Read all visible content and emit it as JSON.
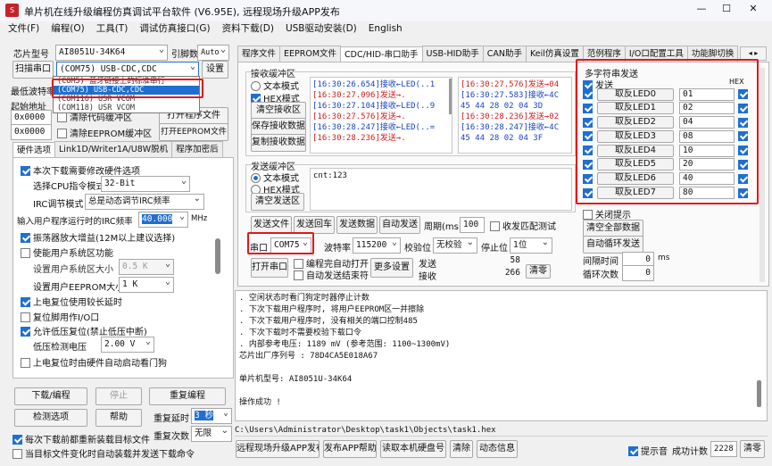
{
  "window": {
    "title": "单片机在线升级编程仿真调试平台软件 (V6.95E), 远程现场升级APP发布",
    "minimize": "—",
    "maximize": "☐",
    "close": "✕"
  },
  "menu": [
    "文件(F)",
    "编程(O)",
    "工具(T)",
    "调试仿真接口(G)",
    "资料下载(D)",
    "USB驱动安装(D)",
    "English"
  ],
  "left": {
    "chip_label": "芯片型号",
    "chip_value": "AI8051U-34K64",
    "pin_label": "引脚数",
    "pin_value": "Auto",
    "scan_button": "扫描串口",
    "port_value": "(COM75) USB-CDC,CDC",
    "settings_button": "设置",
    "dropdown_items": [
      "(COM5) 蓝牙链接上的标准串行",
      "(COM75) USB-CDC,CDC",
      "(COM116) USR VCOM",
      "(COM118) USR VCOM"
    ],
    "baud_label": "最低波特率",
    "start_label": "起始地址",
    "addr1": "0x0000",
    "clear_code": "清除代码缓冲区",
    "open_prog": "打开程序文件",
    "addr2": "0x0000",
    "clear_eeprom": "清除EEPROM缓冲区",
    "open_eeprom": "打开EEPROM文件",
    "tabs": [
      "硬件选项",
      "Link1D/Writer1A/U8W脱机",
      "程序加密后"
    ],
    "hw": {
      "need_modify": "本次下载需要修改硬件选项",
      "cpu_mode_label": "选择CPU指令模式",
      "cpu_mode_value": "32-Bit",
      "irc_label": "IRC调节模式",
      "irc_value": "总是动态调节IRC频率",
      "freq_label": "输入用户程序运行时的IRC频率",
      "freq_value": "40.000",
      "freq_unit": "MHz",
      "osc_gain": "振荡器放大增益(12M以上建议选择)",
      "sys_clk": "使能用户系统区功能",
      "sys_size_label": "设置用户系统区大小",
      "sys_size_value": "0.5 K",
      "eeprom_size_label": "设置用户EEPROM大小",
      "eeprom_size_value": "1  K",
      "power_reset": "上电复位使用较长延时",
      "reset_io": "复位脚用作I/O口",
      "low_volt": "允许低压复位(禁止低压中断)",
      "low_volt_label": "低压检测电压",
      "low_volt_value": "2.00 V",
      "wdt": "上电复位时由硬件自动启动看门狗"
    },
    "download_button": "下载/编程",
    "stop_button": "停止",
    "reprogram_button": "重复编程",
    "check_button": "检测选项",
    "help_button": "帮助",
    "delay_label": "重复延时",
    "delay_value": "3 秒",
    "count_label": "重复次数",
    "count_value": "无限",
    "reload_opt": "每次下载前都重新装载目标文件",
    "auto_load_opt": "当目标文件变化时自动装载并发送下载命令"
  },
  "right_tabs": [
    "程序文件",
    "EEPROM文件",
    "CDC/HID-串口助手",
    "USB-HID助手",
    "CAN助手",
    "Keil仿真设置",
    "范例程序",
    "I/O口配置工具",
    "功能脚切换"
  ],
  "serial": {
    "recv_group": "接收缓冲区",
    "text_mode": "文本模式",
    "hex_mode": "HEX模式",
    "clear_recv": "清空接收区",
    "save_recv": "保存接收数据",
    "copy_recv": "复制接收数据",
    "recv_lines_left": [
      "[16:30:26.654]接收←LED(..1",
      "[16:30:27.096]发送→.",
      "[16:30:27.104]接收←LED(..9",
      "[16:30:27.576]发送→.",
      "[16:30:28.236]发送→.",
      "[16:30:28.236]发送→."
    ],
    "recv_lines_left2": [
      "",
      "",
      "",
      "",
      "[16:30:28.247]接收←LED(..=",
      ""
    ],
    "recv_lines_right": [
      "[16:30:27.576]发送→04",
      "[16:30:27.583]接收←4C",
      "45 44 28 02 04 3D",
      "[16:30:28.236]发送→02",
      "[16:30:28.247]接收←4C",
      "45 44 28 02 04 3F"
    ],
    "send_group": "发送缓冲区",
    "send_text": "文本模式",
    "send_hex": "HEX模式",
    "clear_send": "清空发送区",
    "send_content": "cnt:123",
    "send_file": "发送文件",
    "send_return": "发送回车",
    "send_data": "发送数据",
    "auto_send": "自动发送",
    "period_label": "周期(ms)",
    "period_value": "100",
    "recv_match": "收发匹配测试",
    "port_label": "串口",
    "port_value": "COM75",
    "baud_label": "波特率",
    "baud_value": "115200",
    "parity_label": "校验位",
    "parity_value": "无校验",
    "stop_label": "停止位",
    "stop_value": "1位",
    "open_port": "打开串口",
    "auto_open": "编程完自动打开",
    "auto_close": "自动发送结束符",
    "more_settings": "更多设置",
    "sent_label": "发送",
    "sent_value": "58",
    "recv_label": "接收",
    "recv_value": "266",
    "clear_counts": "清零"
  },
  "multi": {
    "title": "多字符串发送",
    "send_header": "发送",
    "hex_header": "HEX",
    "rows": [
      {
        "label": "取反LED0",
        "value": "01"
      },
      {
        "label": "取反LED1",
        "value": "02"
      },
      {
        "label": "取反LED2",
        "value": "04"
      },
      {
        "label": "取反LED3",
        "value": "08"
      },
      {
        "label": "取反LED4",
        "value": "10"
      },
      {
        "label": "取反LED5",
        "value": "20"
      },
      {
        "label": "取反LED6",
        "value": "40"
      },
      {
        "label": "取反LED7",
        "value": "80"
      }
    ],
    "close_tip": "关闭提示",
    "clear_all": "清空全部数据",
    "auto_loop": "自动循环发送",
    "interval_label": "间隔时间",
    "interval_value": "0",
    "interval_unit": "ms",
    "loop_label": "循环次数",
    "loop_value": "0"
  },
  "log": {
    "lines": [
      ". 空闲状态时看门狗定时器停止计数",
      ". 下次下载用户程序时, 将用户EEPROM区一并擦除",
      ". 下次下载用户程序时, 没有相关的端口控制485",
      ". 下次下载时不需要校验下载口令",
      ". 内部参考电压: 1189 mV (参考范围: 1100~1300mV)",
      "芯片出厂序列号 : 78D4CA5E018A67",
      "",
      "单片机型号: AI8051U-34K64",
      "",
      "操作成功 !"
    ],
    "path": "C:\\Users\\Administrator\\Desktop\\task1\\Objects\\task1.hex"
  },
  "bottom": {
    "remote_upgrade": "远程现场升级APP发布",
    "publish_app": "发布APP帮助",
    "read_disk": "读取本机硬盘号",
    "clear": "清除",
    "anim": "动态信息",
    "tip_sound": "提示音",
    "success_label": "成功计数",
    "success_value": "2228",
    "clear_count": "清零"
  }
}
